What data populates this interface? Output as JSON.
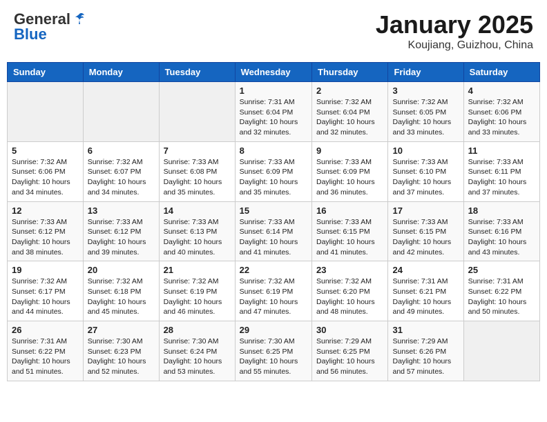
{
  "header": {
    "logo_general": "General",
    "logo_blue": "Blue",
    "month_title": "January 2025",
    "location": "Koujiang, Guizhou, China"
  },
  "weekdays": [
    "Sunday",
    "Monday",
    "Tuesday",
    "Wednesday",
    "Thursday",
    "Friday",
    "Saturday"
  ],
  "weeks": [
    [
      {
        "day": "",
        "info": ""
      },
      {
        "day": "",
        "info": ""
      },
      {
        "day": "",
        "info": ""
      },
      {
        "day": "1",
        "info": "Sunrise: 7:31 AM\nSunset: 6:04 PM\nDaylight: 10 hours\nand 32 minutes."
      },
      {
        "day": "2",
        "info": "Sunrise: 7:32 AM\nSunset: 6:04 PM\nDaylight: 10 hours\nand 32 minutes."
      },
      {
        "day": "3",
        "info": "Sunrise: 7:32 AM\nSunset: 6:05 PM\nDaylight: 10 hours\nand 33 minutes."
      },
      {
        "day": "4",
        "info": "Sunrise: 7:32 AM\nSunset: 6:06 PM\nDaylight: 10 hours\nand 33 minutes."
      }
    ],
    [
      {
        "day": "5",
        "info": "Sunrise: 7:32 AM\nSunset: 6:06 PM\nDaylight: 10 hours\nand 34 minutes."
      },
      {
        "day": "6",
        "info": "Sunrise: 7:32 AM\nSunset: 6:07 PM\nDaylight: 10 hours\nand 34 minutes."
      },
      {
        "day": "7",
        "info": "Sunrise: 7:33 AM\nSunset: 6:08 PM\nDaylight: 10 hours\nand 35 minutes."
      },
      {
        "day": "8",
        "info": "Sunrise: 7:33 AM\nSunset: 6:09 PM\nDaylight: 10 hours\nand 35 minutes."
      },
      {
        "day": "9",
        "info": "Sunrise: 7:33 AM\nSunset: 6:09 PM\nDaylight: 10 hours\nand 36 minutes."
      },
      {
        "day": "10",
        "info": "Sunrise: 7:33 AM\nSunset: 6:10 PM\nDaylight: 10 hours\nand 37 minutes."
      },
      {
        "day": "11",
        "info": "Sunrise: 7:33 AM\nSunset: 6:11 PM\nDaylight: 10 hours\nand 37 minutes."
      }
    ],
    [
      {
        "day": "12",
        "info": "Sunrise: 7:33 AM\nSunset: 6:12 PM\nDaylight: 10 hours\nand 38 minutes."
      },
      {
        "day": "13",
        "info": "Sunrise: 7:33 AM\nSunset: 6:12 PM\nDaylight: 10 hours\nand 39 minutes."
      },
      {
        "day": "14",
        "info": "Sunrise: 7:33 AM\nSunset: 6:13 PM\nDaylight: 10 hours\nand 40 minutes."
      },
      {
        "day": "15",
        "info": "Sunrise: 7:33 AM\nSunset: 6:14 PM\nDaylight: 10 hours\nand 41 minutes."
      },
      {
        "day": "16",
        "info": "Sunrise: 7:33 AM\nSunset: 6:15 PM\nDaylight: 10 hours\nand 41 minutes."
      },
      {
        "day": "17",
        "info": "Sunrise: 7:33 AM\nSunset: 6:15 PM\nDaylight: 10 hours\nand 42 minutes."
      },
      {
        "day": "18",
        "info": "Sunrise: 7:33 AM\nSunset: 6:16 PM\nDaylight: 10 hours\nand 43 minutes."
      }
    ],
    [
      {
        "day": "19",
        "info": "Sunrise: 7:32 AM\nSunset: 6:17 PM\nDaylight: 10 hours\nand 44 minutes."
      },
      {
        "day": "20",
        "info": "Sunrise: 7:32 AM\nSunset: 6:18 PM\nDaylight: 10 hours\nand 45 minutes."
      },
      {
        "day": "21",
        "info": "Sunrise: 7:32 AM\nSunset: 6:19 PM\nDaylight: 10 hours\nand 46 minutes."
      },
      {
        "day": "22",
        "info": "Sunrise: 7:32 AM\nSunset: 6:19 PM\nDaylight: 10 hours\nand 47 minutes."
      },
      {
        "day": "23",
        "info": "Sunrise: 7:32 AM\nSunset: 6:20 PM\nDaylight: 10 hours\nand 48 minutes."
      },
      {
        "day": "24",
        "info": "Sunrise: 7:31 AM\nSunset: 6:21 PM\nDaylight: 10 hours\nand 49 minutes."
      },
      {
        "day": "25",
        "info": "Sunrise: 7:31 AM\nSunset: 6:22 PM\nDaylight: 10 hours\nand 50 minutes."
      }
    ],
    [
      {
        "day": "26",
        "info": "Sunrise: 7:31 AM\nSunset: 6:22 PM\nDaylight: 10 hours\nand 51 minutes."
      },
      {
        "day": "27",
        "info": "Sunrise: 7:30 AM\nSunset: 6:23 PM\nDaylight: 10 hours\nand 52 minutes."
      },
      {
        "day": "28",
        "info": "Sunrise: 7:30 AM\nSunset: 6:24 PM\nDaylight: 10 hours\nand 53 minutes."
      },
      {
        "day": "29",
        "info": "Sunrise: 7:30 AM\nSunset: 6:25 PM\nDaylight: 10 hours\nand 55 minutes."
      },
      {
        "day": "30",
        "info": "Sunrise: 7:29 AM\nSunset: 6:25 PM\nDaylight: 10 hours\nand 56 minutes."
      },
      {
        "day": "31",
        "info": "Sunrise: 7:29 AM\nSunset: 6:26 PM\nDaylight: 10 hours\nand 57 minutes."
      },
      {
        "day": "",
        "info": ""
      }
    ]
  ]
}
